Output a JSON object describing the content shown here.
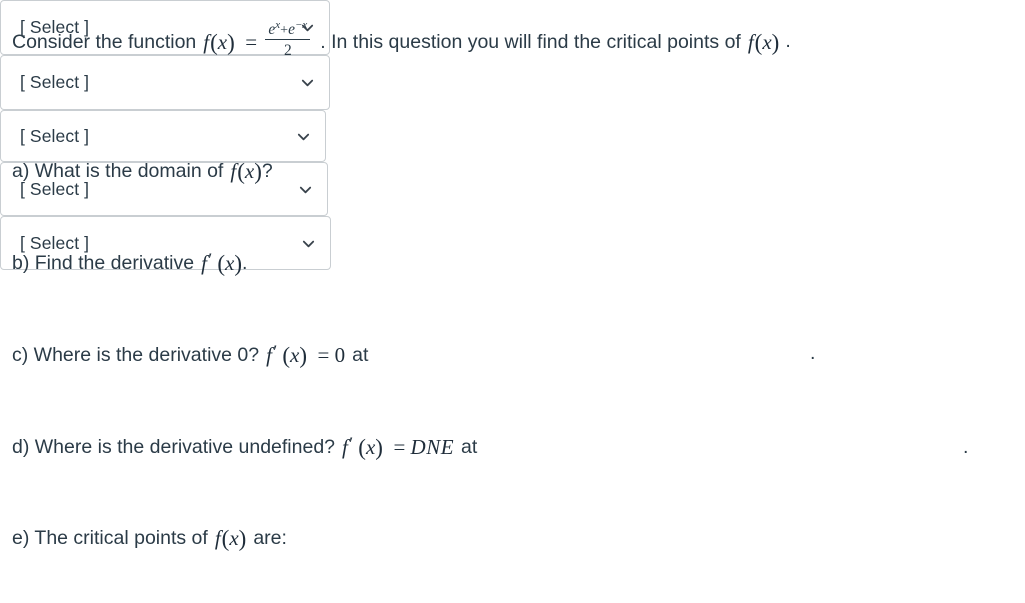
{
  "question": {
    "intro_before_fraction": "Consider the function",
    "function_label": "f (x) =",
    "fraction": {
      "numerator_base1": "e",
      "numerator_exp1": "x",
      "numerator_plus": "+",
      "numerator_base2": "e",
      "numerator_exp2": "−x",
      "denominator": "2"
    },
    "intro_after_fraction": ". In this question you will find the critical points of",
    "intro_trailing_math": "f (x)",
    "intro_trailing_period": "."
  },
  "parts": [
    {
      "id": "a",
      "prompt_text": "a) What is the domain of",
      "math": "f (x)",
      "prompt_suffix": "?",
      "select_value": "[ Select ]",
      "trailing_period": ""
    },
    {
      "id": "b",
      "prompt_text": "b) Find the derivative",
      "math": "f′ (x)",
      "prompt_suffix": ".",
      "select_value": "[ Select ]",
      "trailing_period": ""
    },
    {
      "id": "c",
      "prompt_text": "c) Where is the derivative 0?",
      "math": "f′ (x) = 0",
      "prompt_suffix": "at",
      "select_value": "[ Select ]",
      "trailing_period": "."
    },
    {
      "id": "d",
      "prompt_text": "d) Where is the derivative undefined?",
      "math": "f′ (x) = DNE",
      "prompt_suffix": "at",
      "select_value": "[ Select ]",
      "trailing_period": "."
    },
    {
      "id": "e",
      "prompt_text": "e) The critical points of",
      "math": "f (x)",
      "prompt_suffix": "are:",
      "select_value": "[ Select ]",
      "trailing_period": ""
    }
  ],
  "icons": {
    "dropdown": "chevron-down-icon"
  },
  "colors": {
    "text": "#2b3b47",
    "border": "#c9ced2",
    "background": "#ffffff"
  }
}
